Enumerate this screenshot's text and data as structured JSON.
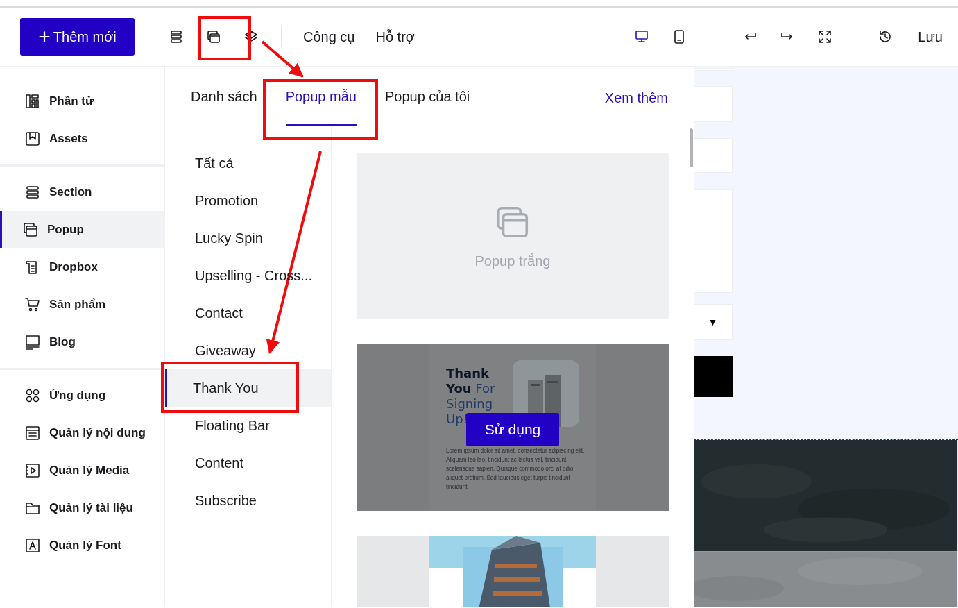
{
  "toolbar": {
    "add_button": {
      "icon": "+",
      "label": "Thêm mới"
    },
    "tools": [
      {
        "kind": "sections",
        "selected": false
      },
      {
        "kind": "popups",
        "selected": false
      },
      {
        "kind": "layers",
        "selected": false
      }
    ],
    "menus": [
      "Công cụ",
      "Hỗ trợ"
    ],
    "views": [
      {
        "kind": "desktop",
        "selected": true
      },
      {
        "kind": "tablet",
        "selected": false
      }
    ],
    "actions": [
      {
        "kind": "undo"
      },
      {
        "kind": "redo"
      },
      {
        "kind": "fullscreen"
      }
    ],
    "history": {
      "kind": "history"
    },
    "save": "Lưu"
  },
  "sidebar": {
    "groups": [
      [
        {
          "label": "Phần tử",
          "kind": "elements",
          "selected": false
        },
        {
          "label": "Assets",
          "kind": "assets",
          "selected": false
        }
      ],
      [
        {
          "label": "Section",
          "kind": "section",
          "selected": false
        },
        {
          "label": "Popup",
          "kind": "popup",
          "selected": true
        },
        {
          "label": "Dropbox",
          "kind": "dropbox",
          "selected": false
        },
        {
          "label": "Sản phẩm",
          "kind": "cart",
          "selected": false
        },
        {
          "label": "Blog",
          "kind": "blog",
          "selected": false
        }
      ],
      [
        {
          "label": "Ứng dụng",
          "kind": "apps",
          "selected": false
        },
        {
          "label": "Quản lý nội dung",
          "kind": "content",
          "selected": false
        },
        {
          "label": "Quản lý Media",
          "kind": "media",
          "selected": false
        },
        {
          "label": "Quản lý tài liệu",
          "kind": "folder",
          "selected": false
        },
        {
          "label": "Quản lý Font",
          "kind": "font",
          "selected": false
        }
      ]
    ]
  },
  "tabs": [
    {
      "label": "Danh sách",
      "selected": false
    },
    {
      "label": "Popup mẫu",
      "selected": true
    },
    {
      "label": "Popup của tôi",
      "selected": false
    }
  ],
  "more_link": "Xem thêm",
  "categories": [
    {
      "label": "Tất cả",
      "selected": false
    },
    {
      "label": "Promotion",
      "selected": false
    },
    {
      "label": "Lucky Spin",
      "selected": false
    },
    {
      "label": "Upselling - Cross...",
      "selected": false
    },
    {
      "label": "Contact",
      "selected": false
    },
    {
      "label": "Giveaway",
      "selected": false
    },
    {
      "label": "Thank You",
      "selected": true
    },
    {
      "label": "Floating Bar",
      "selected": false
    },
    {
      "label": "Content",
      "selected": false
    },
    {
      "label": "Subscribe",
      "selected": false
    }
  ],
  "templates": [
    {
      "kind": "blank",
      "label": "Popup trắng"
    },
    {
      "kind": "preview",
      "title": "**Thank You** For Signing Up!",
      "body": "Lorem ipsum dolor sit amet, consectetur adipiscing elit. Aliquam leo leo, tincidunt ac lectus vel, tincidunt scelerisque sapien. Quisque commodo orci at odio aliquet pretium. Sed faucibus eget turpis tincidunt tincidunt.",
      "action": "Sử dụng"
    },
    {
      "kind": "picture"
    }
  ],
  "canvas": {
    "dropdown_caret": "▼"
  }
}
